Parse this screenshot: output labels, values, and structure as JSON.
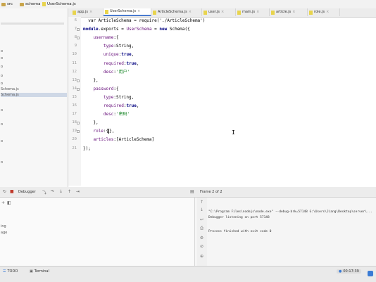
{
  "breadcrumbs": [
    {
      "label": "src"
    },
    {
      "label": "schema"
    },
    {
      "label": "UserSchema.js"
    }
  ],
  "project_panel": {
    "lines": [
      "o",
      "o",
      "o",
      "o",
      "o",
      "Schema.js",
      "Schema.js",
      "o",
      "o",
      "o",
      "o"
    ],
    "selected_index": 6
  },
  "editor_tabs": [
    {
      "label": "app.js",
      "active": false
    },
    {
      "label": "UserSchema.js",
      "active": true
    },
    {
      "label": "ArticleSchema.js",
      "active": false
    },
    {
      "label": "user.js",
      "active": false
    },
    {
      "label": "main.js",
      "active": false
    },
    {
      "label": "article.js",
      "active": false
    },
    {
      "label": "role.js",
      "active": false
    }
  ],
  "code": {
    "line_numbers": [
      "6",
      "7",
      "8",
      "9",
      "10",
      "11",
      "12",
      "13",
      "14",
      "15",
      "16",
      "17",
      "18",
      "19",
      "20",
      "21"
    ],
    "lines": [
      [
        {
          "t": "n",
          "v": "  var ArticleSchema = require('./ArticleSchema')"
        }
      ],
      [
        {
          "t": "k",
          "v": "module"
        },
        {
          "t": "n",
          "v": ".exports = "
        },
        {
          "t": "p",
          "v": "UserSchema"
        },
        {
          "t": "n",
          "v": " = "
        },
        {
          "t": "k",
          "v": "new "
        },
        {
          "t": "n",
          "v": "Schema({"
        }
      ],
      [
        {
          "t": "n",
          "v": "    "
        },
        {
          "t": "p",
          "v": "username"
        },
        {
          "t": "n",
          "v": ":{"
        }
      ],
      [
        {
          "t": "n",
          "v": "        "
        },
        {
          "t": "p",
          "v": "type"
        },
        {
          "t": "n",
          "v": ":String,"
        }
      ],
      [
        {
          "t": "n",
          "v": "        "
        },
        {
          "t": "p",
          "v": "unique"
        },
        {
          "t": "n",
          "v": ":"
        },
        {
          "t": "k",
          "v": "true"
        },
        {
          "t": "n",
          "v": ","
        }
      ],
      [
        {
          "t": "n",
          "v": "        "
        },
        {
          "t": "p",
          "v": "required"
        },
        {
          "t": "n",
          "v": ":"
        },
        {
          "t": "k",
          "v": "true"
        },
        {
          "t": "n",
          "v": ","
        }
      ],
      [
        {
          "t": "n",
          "v": "        "
        },
        {
          "t": "p",
          "v": "desc"
        },
        {
          "t": "n",
          "v": ":"
        },
        {
          "t": "s",
          "v": "'用户'"
        }
      ],
      [
        {
          "t": "n",
          "v": "    },"
        }
      ],
      [
        {
          "t": "n",
          "v": "    "
        },
        {
          "t": "p",
          "v": "password"
        },
        {
          "t": "n",
          "v": ":{"
        }
      ],
      [
        {
          "t": "n",
          "v": "        "
        },
        {
          "t": "p",
          "v": "type"
        },
        {
          "t": "n",
          "v": ":String,"
        }
      ],
      [
        {
          "t": "n",
          "v": "        "
        },
        {
          "t": "p",
          "v": "required"
        },
        {
          "t": "n",
          "v": ":"
        },
        {
          "t": "k",
          "v": "true"
        },
        {
          "t": "n",
          "v": ","
        }
      ],
      [
        {
          "t": "n",
          "v": "        "
        },
        {
          "t": "p",
          "v": "desc"
        },
        {
          "t": "n",
          "v": ":"
        },
        {
          "t": "s",
          "v": "'密码'"
        }
      ],
      [
        {
          "t": "n",
          "v": "    },"
        }
      ],
      [
        {
          "t": "n",
          "v": "    "
        },
        {
          "t": "p",
          "v": "role"
        },
        {
          "t": "n",
          "v": ":{"
        },
        {
          "t": "caret",
          "v": ""
        },
        {
          "t": "n",
          "v": "},"
        }
      ],
      [
        {
          "t": "n",
          "v": "    "
        },
        {
          "t": "p",
          "v": "articles"
        },
        {
          "t": "n",
          "v": ":[ArticleSchema]"
        }
      ],
      [
        {
          "t": "n",
          "v": "});"
        }
      ]
    ],
    "fold_lines": [
      1,
      2,
      7,
      8,
      12,
      13
    ]
  },
  "debug": {
    "tab_label": "Debugger",
    "frames_text": "Frame 2 of 2",
    "sidebar_lines": [
      "ing",
      "age"
    ]
  },
  "console": {
    "lines": [
      "\"C:\\Program Files\\nodejs\\node.exe\" --debug-brk=57148 G:\\Users\\Jiang\\Desktop\\server\\...",
      "Debugger listening on port 57148",
      "",
      "Process finished with exit code 0"
    ]
  },
  "status_bar": {
    "left": [
      "TODO",
      "Terminal"
    ],
    "time": "00:17:39"
  },
  "colors": {
    "accent": "#4a7bd0",
    "keyword": "#000080",
    "property": "#660e7a",
    "string": "#067d17"
  }
}
